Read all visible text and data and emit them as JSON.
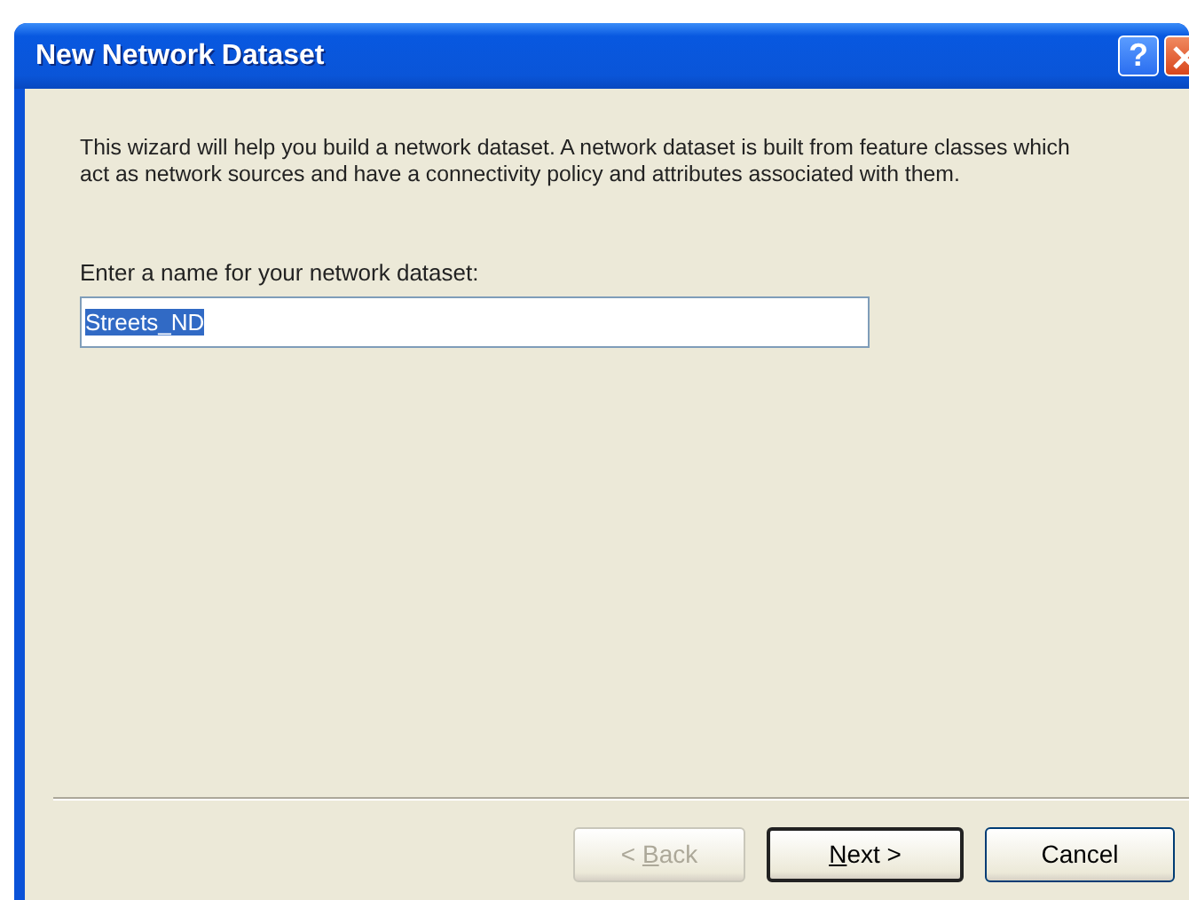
{
  "window": {
    "title": "New Network Dataset",
    "title_buttons": [
      {
        "kind": "help",
        "glyph": "?"
      },
      {
        "kind": "close"
      }
    ]
  },
  "intro": "This wizard will help you build a network dataset.  A network dataset is built from feature classes which act as network sources and have a connectivity policy and attributes associated with them.",
  "name_field": {
    "label": "Enter a name for your network dataset:",
    "value": "Streets_ND",
    "text_selected": true
  },
  "buttons": [
    {
      "text_before": "< ",
      "access_key": "B",
      "text_after": "ack",
      "disabled": true,
      "default": false
    },
    {
      "access_key": "N",
      "text_after": "ext >",
      "disabled": false,
      "default": true
    },
    {
      "text_before": "Cancel",
      "disabled": false,
      "default": false
    }
  ]
}
